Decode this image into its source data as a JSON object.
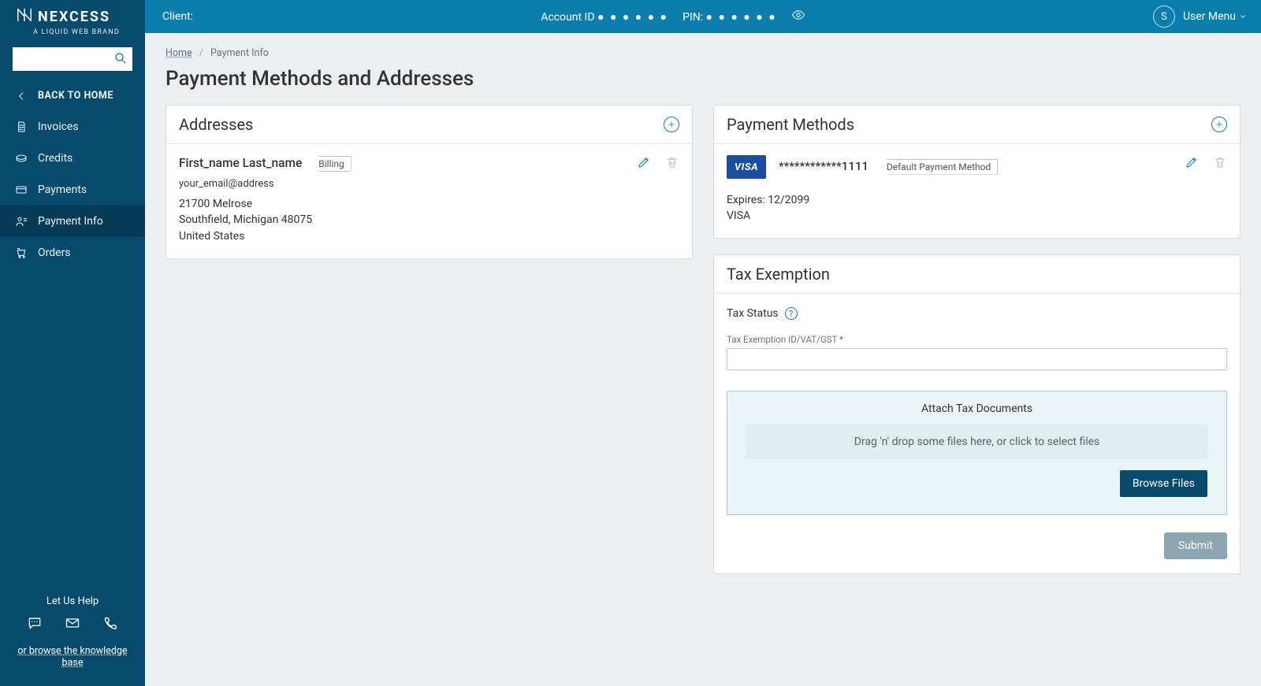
{
  "brand": {
    "name": "NEXCESS",
    "tagline": "A LIQUID WEB BRAND"
  },
  "sidebar": {
    "back_label": "BACK TO HOME",
    "items": [
      {
        "label": "Invoices"
      },
      {
        "label": "Credits"
      },
      {
        "label": "Payments"
      },
      {
        "label": "Payment Info"
      },
      {
        "label": "Orders"
      }
    ],
    "help_heading": "Let Us Help",
    "kb_link": "or browse the knowledge base"
  },
  "topbar": {
    "client_label": "Client:",
    "account_label": "Account ID",
    "account_mask": "● ● ● ● ● ●",
    "pin_label": "PIN:",
    "pin_mask": "● ● ● ● ● ●",
    "avatar_initial": "S",
    "user_menu": "User Menu"
  },
  "breadcrumbs": {
    "home": "Home",
    "current": "Payment Info"
  },
  "page_title": "Payment Methods and Addresses",
  "addresses": {
    "heading": "Addresses",
    "entry": {
      "name": "First_name Last_name",
      "tag": "Billing",
      "email": "your_email@address",
      "line1": "21700 Melrose",
      "line2": "Southfield, Michigan 48075",
      "line3": "United States"
    }
  },
  "payment_methods": {
    "heading": "Payment Methods",
    "entry": {
      "brand": "VISA",
      "number": "************1111",
      "tag": "Default Payment Method",
      "expires_label": "Expires: 12/2099",
      "type": "VISA"
    }
  },
  "tax": {
    "heading": "Tax Exemption",
    "status_label": "Tax Status",
    "id_label": "Tax Exemption ID/VAT/GST *",
    "attach_heading": "Attach Tax Documents",
    "dropzone_text": "Drag 'n' drop some files here, or click to select files",
    "browse_label": "Browse Files",
    "submit_label": "Submit"
  }
}
